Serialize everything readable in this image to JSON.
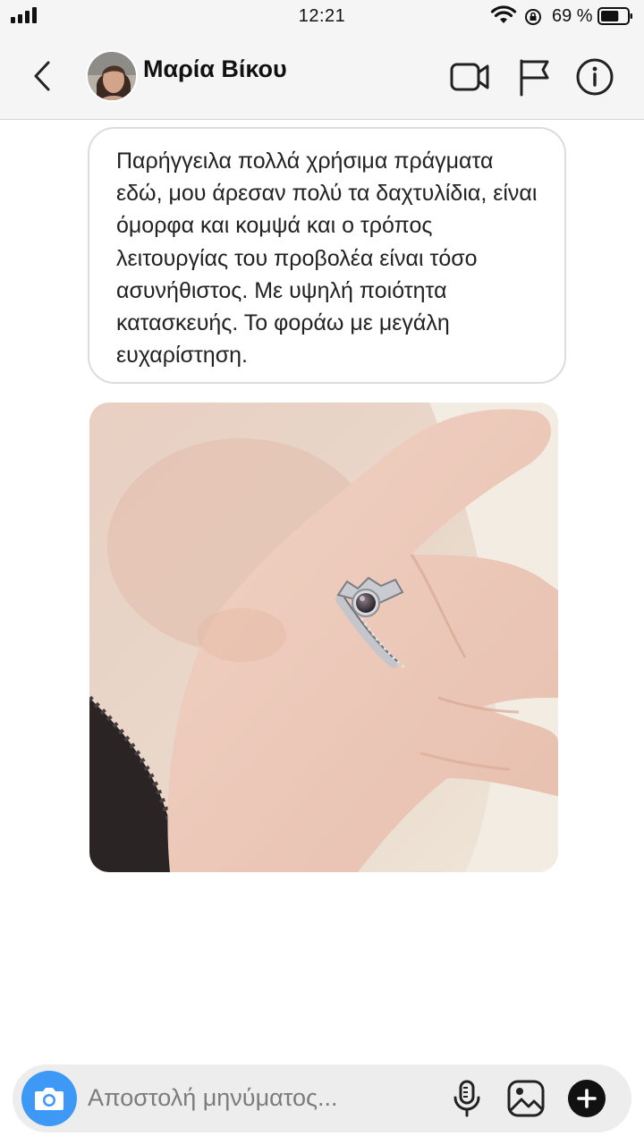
{
  "status_bar": {
    "time": "12:21",
    "battery_percent": "69 %",
    "battery_level": 0.69,
    "icons": [
      "signal-icon",
      "wifi-icon",
      "orientation-lock-icon",
      "battery-icon"
    ]
  },
  "header": {
    "contact_name": "Μαρία Βίκου",
    "icons": [
      "back-chevron-icon",
      "video-call-icon",
      "flag-icon",
      "info-icon"
    ]
  },
  "message": {
    "text": "Παρήγγειλα πολλά χρήσιμα πράγματα εδώ, μου άρεσαν πολύ τα δαχτυλίδια, είναι όμορφα και κομψά και ο τρόπος λειτουργίας του προβολέα είναι τόσο ασυνήθιστος. Με υψηλή ποιότητα κατασκευής. Το φοράω με μεγάλη ευχαρίστηση."
  },
  "composer": {
    "placeholder": "Αποστολή μηνύματος...",
    "icons": [
      "camera-icon",
      "microphone-icon",
      "gallery-icon",
      "plus-icon"
    ]
  },
  "colors": {
    "accent_blue": "#3e98f5",
    "header_bg": "#f5f5f5",
    "composer_bg": "#ededed"
  }
}
